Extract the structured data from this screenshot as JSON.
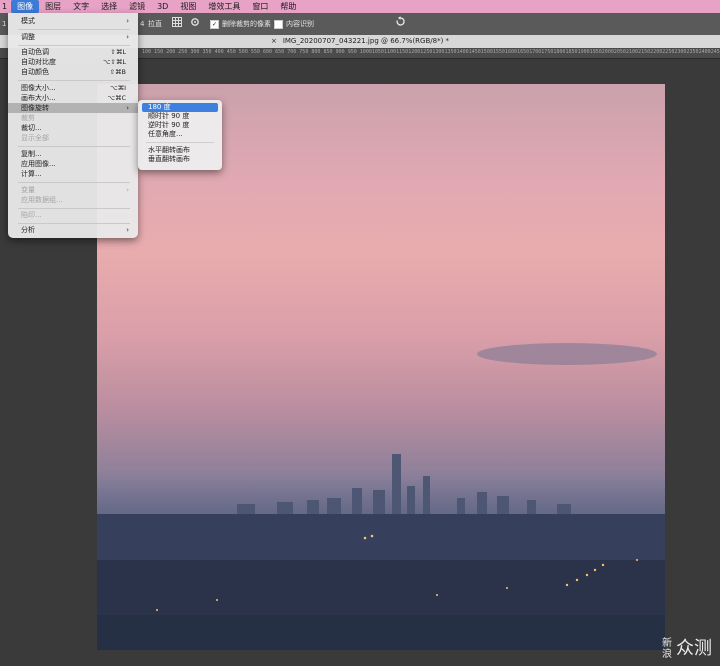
{
  "menubar": {
    "items": [
      "1",
      "图像",
      "图层",
      "文字",
      "选择",
      "滤镜",
      "3D",
      "视图",
      "增效工具",
      "窗口",
      "帮助"
    ],
    "active_index": 1
  },
  "options_bar": {
    "fragment_left": "1",
    "fragment_mid": "4",
    "clear_label": "拉直",
    "delete_cropped_label": "删除裁剪的像素",
    "delete_cropped_checked": true,
    "content_aware_label": "内容识别",
    "content_aware_checked": false
  },
  "document": {
    "tab_title": "IMG_20200707_043221.jpg @ 66.7%(RGB/8*) *"
  },
  "ruler_ticks": [
    "100",
    "150",
    "200",
    "250",
    "300",
    "350",
    "400",
    "450",
    "500",
    "550",
    "600",
    "650",
    "700",
    "750",
    "800",
    "850",
    "900",
    "950",
    "1000",
    "1050",
    "1100",
    "1150",
    "1200",
    "1250",
    "1300",
    "1350",
    "1400",
    "1450",
    "1500",
    "1550",
    "1600",
    "1650",
    "1700",
    "1750",
    "1800",
    "1850",
    "1900",
    "1950",
    "2000",
    "2050",
    "2100",
    "2150",
    "2200",
    "2250",
    "2300",
    "2350",
    "2400",
    "2450",
    "2500",
    "2550",
    "2600",
    "2650",
    "2700",
    "2750",
    "2800",
    "2850",
    "2900",
    "2950",
    "3000",
    "3050"
  ],
  "image_menu": {
    "mode": "模式",
    "adjustments": "调整",
    "auto_tone": "自动色调",
    "auto_tone_sc": "⇧⌘L",
    "auto_contrast": "自动对比度",
    "auto_contrast_sc": "⌥⇧⌘L",
    "auto_color": "自动颜色",
    "auto_color_sc": "⇧⌘B",
    "image_size": "图像大小...",
    "image_size_sc": "⌥⌘I",
    "canvas_size": "画布大小...",
    "canvas_size_sc": "⌥⌘C",
    "image_rotation": "图像旋转",
    "crop": "裁剪",
    "trim": "裁切...",
    "reveal_all": "显示全部",
    "duplicate": "复制...",
    "apply_image": "应用图像...",
    "calculations": "计算...",
    "variables": "变量",
    "apply_dataset": "应用数据组...",
    "trap": "陷印...",
    "analysis": "分析"
  },
  "rotation_submenu": {
    "items": [
      "180 度",
      "顺时针 90 度",
      "逆时针 90 度",
      "任意角度..."
    ],
    "flip_items": [
      "水平翻转画布",
      "垂直翻转画布"
    ],
    "selected_index": 0
  },
  "watermark": {
    "small": "新浪",
    "large": "众测"
  }
}
